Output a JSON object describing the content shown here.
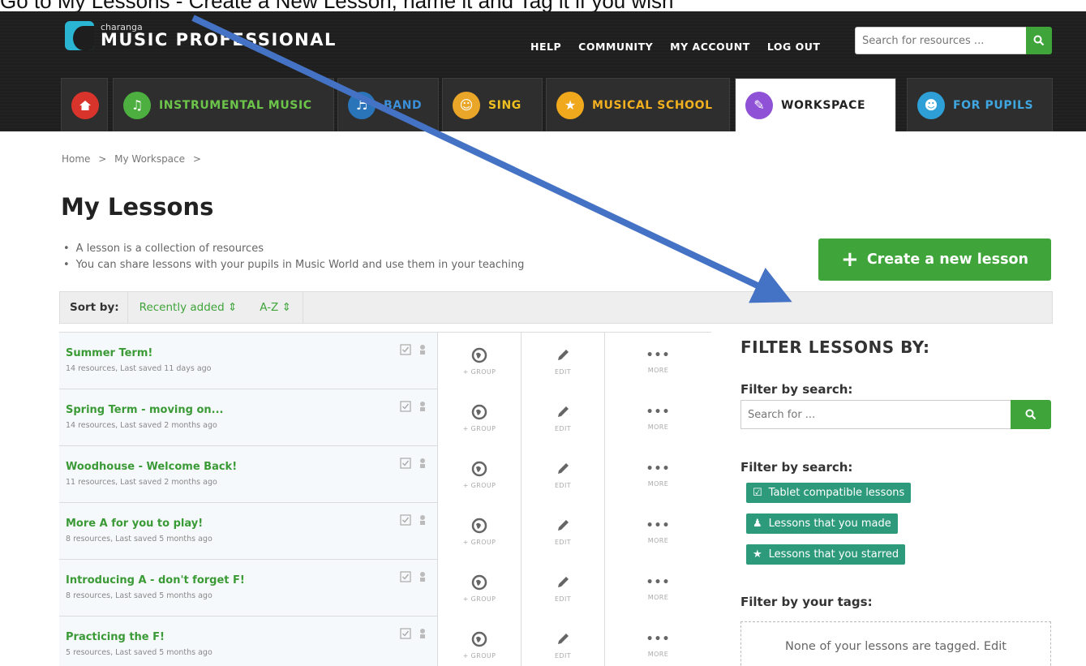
{
  "instruction": "Go to My Lessons - Create a New Lesson, name it and Tag it if you wish",
  "header": {
    "logo_small": "charanga",
    "logo_big": "MUSIC PROFESSIONAL",
    "nav": [
      "HELP",
      "COMMUNITY",
      "MY ACCOUNT",
      "LOG OUT"
    ],
    "search_placeholder": "Search for resources ..."
  },
  "tabs": [
    {
      "label": "",
      "icon": "home-icon",
      "color": "#d9342b"
    },
    {
      "label": "INSTRUMENTAL MUSIC",
      "icon": "instrument-icon",
      "color": "#4caf3f"
    },
    {
      "label": "BAND",
      "icon": "band-icon",
      "color": "#2a74b9"
    },
    {
      "label": "SING",
      "icon": "sing-icon",
      "color": "#e9a628"
    },
    {
      "label": "MUSICAL SCHOOL",
      "icon": "musical-school-icon",
      "color": "#f0a81c"
    },
    {
      "label": "WORKSPACE",
      "icon": "workspace-icon",
      "color": "#8f52d6"
    },
    {
      "label": "FOR PUPILS",
      "icon": "pupils-icon",
      "color": "#2f9fd8"
    }
  ],
  "tab_label_colors": [
    "#ffffff",
    "#6cc44a",
    "#3a8fd8",
    "#f0c020",
    "#f0b020",
    "#222222",
    "#3fa6e0"
  ],
  "breadcrumb": [
    "Home",
    ">",
    "My Workspace",
    ">"
  ],
  "page_title": "My Lessons",
  "intro": [
    "A lesson is a collection of resources",
    "You can share lessons with your pupils in Music World and use them in your teaching"
  ],
  "create_button": "Create a new lesson",
  "sort": {
    "label": "Sort by:",
    "options": [
      "Recently added ⇕",
      "A-Z ⇕"
    ]
  },
  "lessons": [
    {
      "name": "Summer Term!",
      "meta": "14 resources, Last saved 11 days ago"
    },
    {
      "name": "Spring Term - moving on...",
      "meta": "14 resources, Last saved 2 months ago"
    },
    {
      "name": "Woodhouse - Welcome Back!",
      "meta": "11 resources, Last saved 2 months ago"
    },
    {
      "name": "More A for you to play!",
      "meta": "8 resources, Last saved 5 months ago"
    },
    {
      "name": "Introducing A - don't forget F!",
      "meta": "8 resources, Last saved 5 months ago"
    },
    {
      "name": "Practicing the F!",
      "meta": "5 resources, Last saved 5 months ago"
    }
  ],
  "row_actions": {
    "group": "+ GROUP",
    "edit": "EDIT",
    "more": "MORE"
  },
  "filter": {
    "title": "FILTER LESSONS BY:",
    "search_label": "Filter by search:",
    "search_placeholder": "Search for ...",
    "type_label": "Filter by search:",
    "chips": [
      "Tablet compatible lessons",
      "Lessons that you made",
      "Lessons that you starred"
    ],
    "tags_label": "Filter by your tags:",
    "tags_empty": "None of your lessons are tagged. Edit"
  },
  "colors": {
    "accent": "#3fa43a",
    "chip": "#2e9a7c",
    "arrow": "#4472c4"
  }
}
